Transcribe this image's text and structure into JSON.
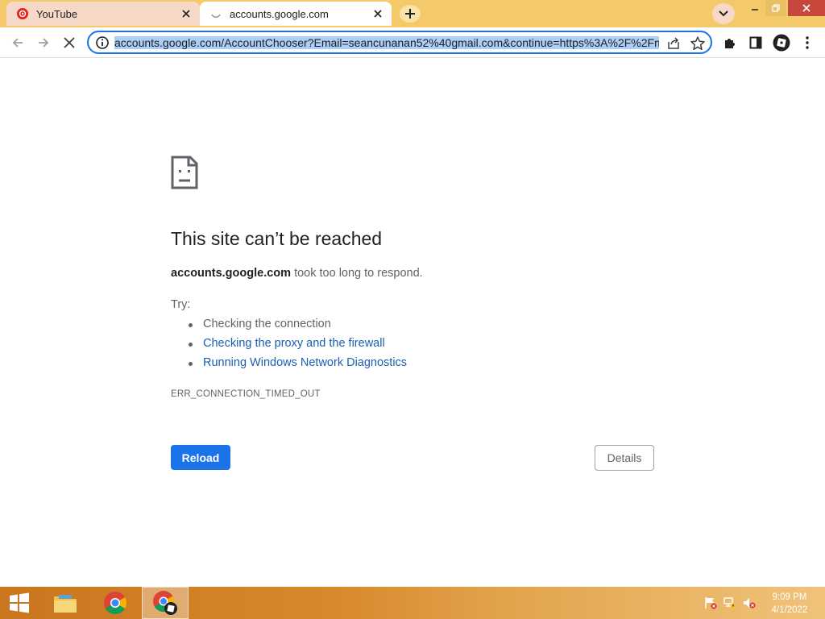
{
  "tabs": [
    {
      "label": "YouTube",
      "icon": "youtube-icon"
    },
    {
      "label": "accounts.google.com",
      "icon": "loading-spinner-icon"
    }
  ],
  "omnibox": {
    "url": "accounts.google.com/AccountChooser?Email=seancunanan52%40gmail.com&continue=https%3A%2F%2Fmy"
  },
  "error": {
    "title": "This site can’t be reached",
    "host": "accounts.google.com",
    "message_suffix": " took too long to respond.",
    "try_label": "Try:",
    "suggestions": [
      "Checking the connection",
      "Checking the proxy and the firewall",
      "Running Windows Network Diagnostics"
    ],
    "code": "ERR_CONNECTION_TIMED_OUT",
    "reload_label": "Reload",
    "details_label": "Details"
  },
  "taskbar": {
    "time": "9:09 PM",
    "date": "4/1/2022"
  },
  "colors": {
    "accent": "#1a73e8",
    "link": "#1a5fb4",
    "tabstrip": "#f4c96a"
  }
}
